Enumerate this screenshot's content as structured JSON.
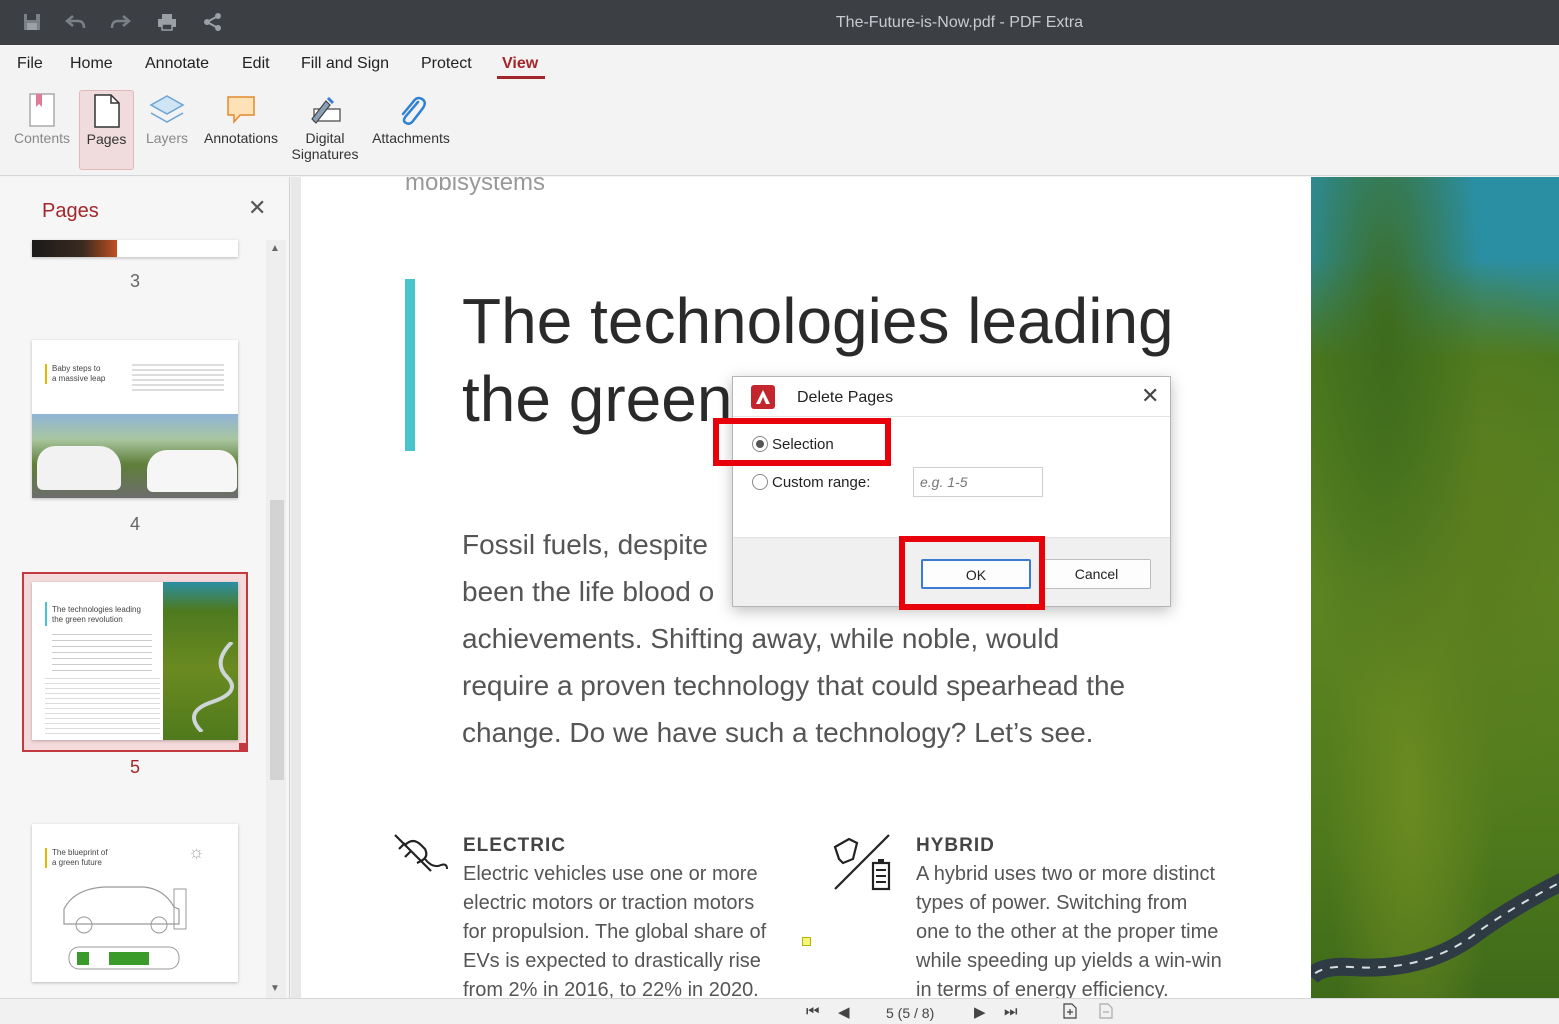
{
  "window": {
    "title": "The-Future-is-Now.pdf - PDF Extra"
  },
  "titlebar_icons": [
    "save-icon",
    "undo-icon",
    "redo-icon",
    "print-icon",
    "share-icon"
  ],
  "menu": {
    "file": "File",
    "home": "Home",
    "annotate": "Annotate",
    "edit": "Edit",
    "fill_sign": "Fill and Sign",
    "protect": "Protect",
    "view": "View"
  },
  "accent_color": "#a3262a",
  "ribbon": {
    "contents": "Contents",
    "pages": "Pages",
    "layers": "Layers",
    "annotations": "Annotations",
    "digital_signatures_line1": "Digital",
    "digital_signatures_line2": "Signatures",
    "attachments": "Attachments"
  },
  "panel": {
    "title": "Pages",
    "pages": [
      {
        "num": "3"
      },
      {
        "num": "4",
        "heading_line1": "Baby steps to",
        "heading_line2": "a massive leap"
      },
      {
        "num": "5",
        "heading_line1": "The technologies leading",
        "heading_line2": "the green revolution",
        "current": true
      },
      {
        "num": "",
        "heading_line1": "The blueprint of",
        "heading_line2": "a green future"
      }
    ]
  },
  "document": {
    "brand": "mobisystems",
    "headline_line1": "The technologies leading",
    "headline_line2": "the green",
    "body_lines": [
      "Fossil fuels, despite",
      "been the life blood o",
      "achievements. Shifting away, while noble, would",
      "require a proven technology that could spearhead the",
      "change. Do we have such a technology? Let’s see."
    ],
    "features": [
      {
        "title": "ELECTRIC",
        "lines": [
          "Electric vehicles use one or more",
          "electric motors or traction motors",
          "for propulsion. The global share of",
          "EVs is expected to drastically rise",
          "from 2% in 2016, to 22% in 2020."
        ]
      },
      {
        "title": "HYBRID",
        "lines": [
          "A hybrid uses two or more distinct",
          "types of power. Switching from",
          "one to the other at the proper time",
          "while speeding up yields a win-win",
          "in terms of energy efficiency."
        ]
      }
    ]
  },
  "status": {
    "page_indicator": "5 (5 / 8)"
  },
  "dialog": {
    "title": "Delete Pages",
    "option_selection": "Selection",
    "option_custom_range": "Custom range:",
    "range_placeholder": "e.g. 1-5",
    "selected_option": "Selection",
    "ok_label": "OK",
    "cancel_label": "Cancel"
  },
  "highlight_color": "#e8000a"
}
